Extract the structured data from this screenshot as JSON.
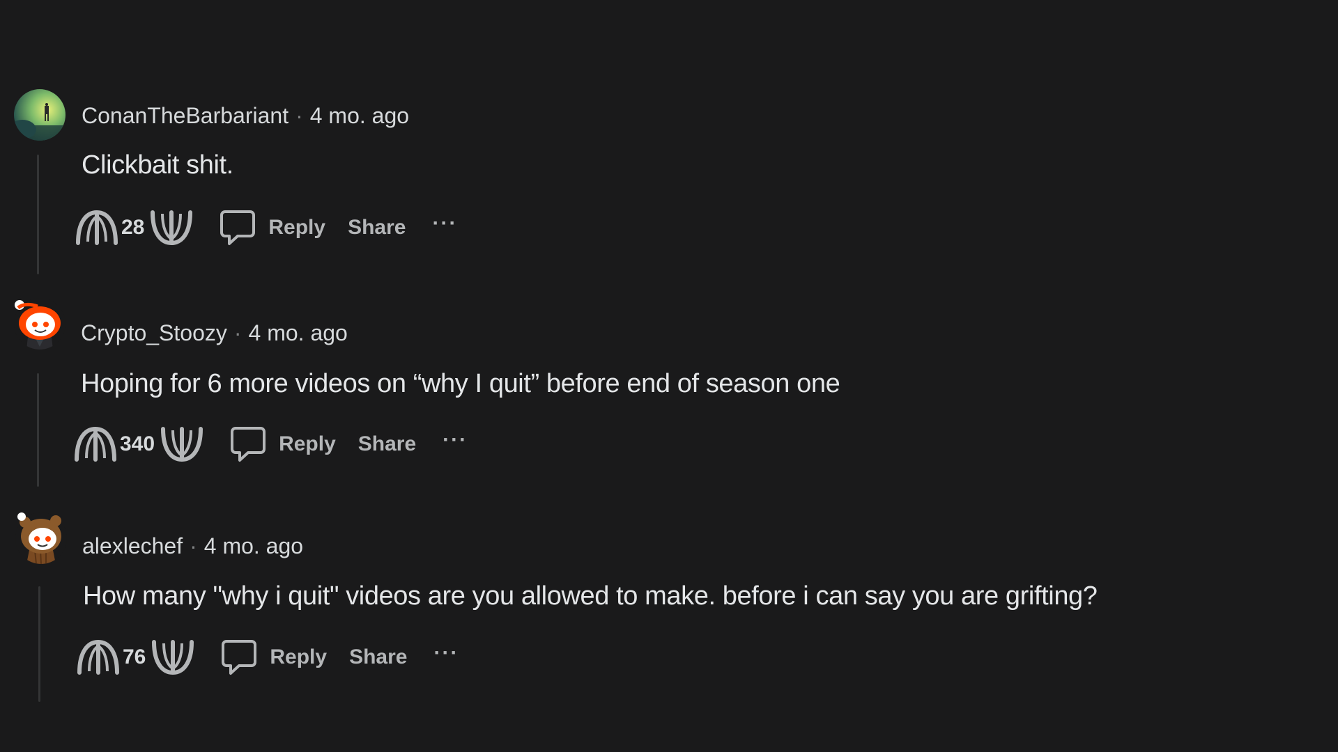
{
  "comments": [
    {
      "author": "ConanTheBarbariant",
      "separator": "·",
      "time": "4 mo. ago",
      "text": "Clickbait shit.",
      "score": "28",
      "reply_label": "Reply",
      "share_label": "Share",
      "more_label": "···",
      "avatar_icon": "landscape-figure-avatar-icon"
    },
    {
      "author": "Crypto_Stoozy",
      "separator": "·",
      "time": "4 mo. ago",
      "text": "Hoping for 6 more videos on “why I quit” before end of season one",
      "score": "340",
      "reply_label": "Reply",
      "share_label": "Share",
      "more_label": "···",
      "avatar_icon": "snoo-avatar-icon"
    },
    {
      "author": "alexlechef",
      "separator": "·",
      "time": "4 mo. ago",
      "text": "How many \"why i quit\" videos are you allowed to make. before i can say you are grifting?",
      "score": "76",
      "reply_label": "Reply",
      "share_label": "Share",
      "more_label": "···",
      "avatar_icon": "snoo-bear-avatar-icon"
    }
  ],
  "colors": {
    "background": "#1a1a1b",
    "text": "#d7dadc",
    "muted": "#818384",
    "snoo_orange": "#ff4500"
  }
}
